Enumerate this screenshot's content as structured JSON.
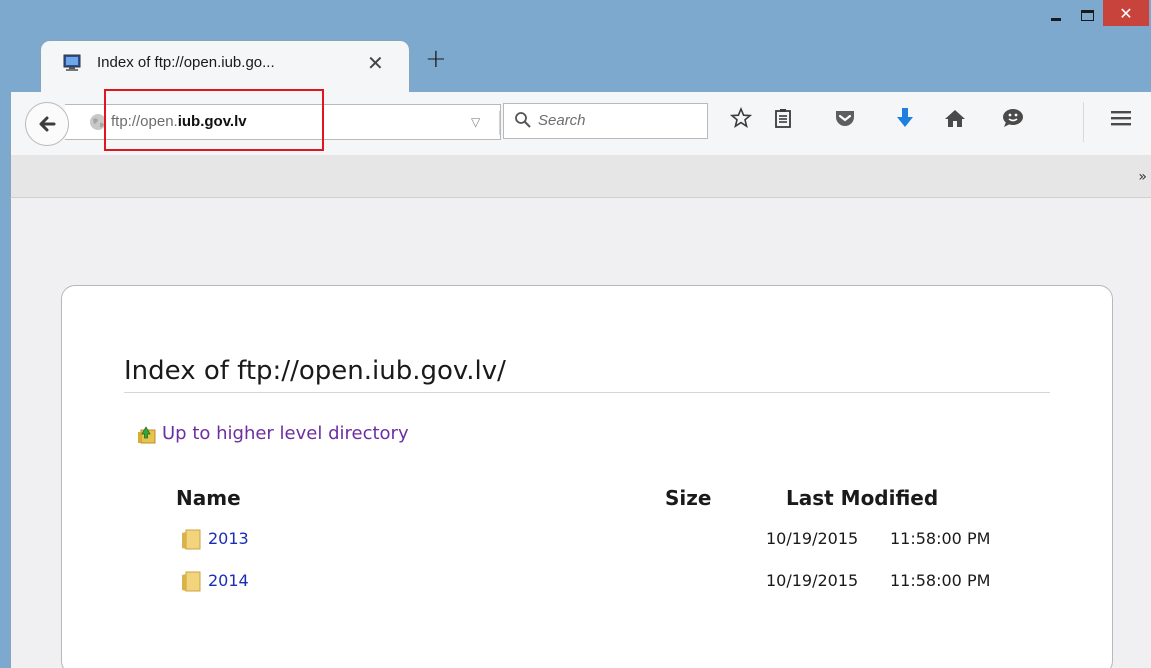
{
  "tab": {
    "title": "Index of ftp://open.iub.go...",
    "close_glyph": "✕",
    "new_tab_glyph": "+"
  },
  "window": {
    "close_glyph": "✕"
  },
  "navbar": {
    "url_prefix": "ftp://open.",
    "url_bold": "iub.gov.lv",
    "search_placeholder": "Search",
    "dropdown_glyph": "▽",
    "reload_glyph": "C"
  },
  "bookmarks": {
    "overflow_glyph": "»"
  },
  "page": {
    "title": "Index of ftp://open.iub.gov.lv/",
    "up_link": "Up to higher level directory",
    "columns": {
      "name": "Name",
      "size": "Size",
      "modified": "Last Modified"
    },
    "rows": [
      {
        "name": "2013",
        "size": "",
        "date": "10/19/2015",
        "time": "11:58:00 PM"
      },
      {
        "name": "2014",
        "size": "",
        "date": "10/19/2015",
        "time": "11:58:00 PM"
      }
    ]
  },
  "colors": {
    "link_visited": "#6b2fa0",
    "link": "#1a2db5",
    "highlight_box": "#e0161e",
    "download_arrow": "#1e7fe0"
  }
}
